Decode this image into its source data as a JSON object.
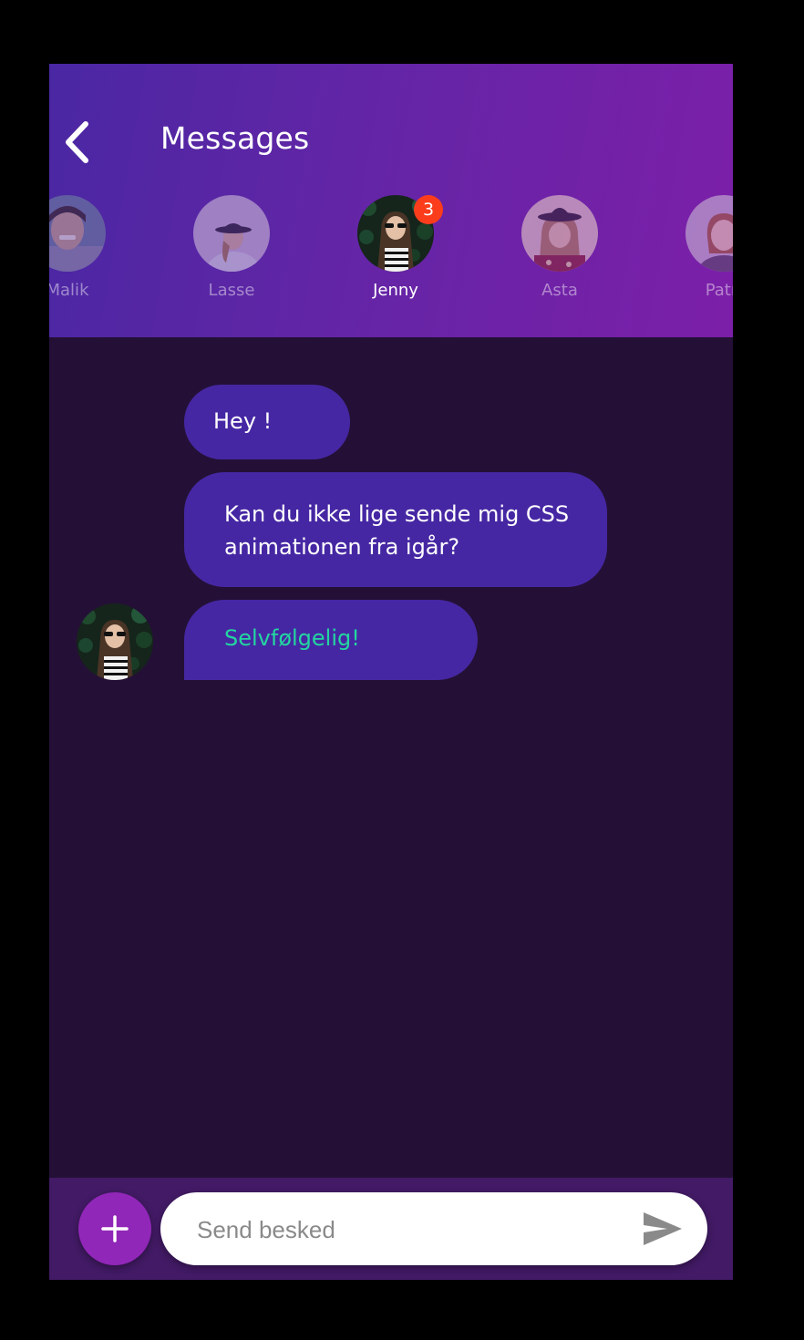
{
  "header": {
    "title": "Messages"
  },
  "contacts": [
    {
      "name": "Malik",
      "active": false,
      "badge": null
    },
    {
      "name": "Lasse",
      "active": false,
      "badge": null
    },
    {
      "name": "Jenny",
      "active": true,
      "badge": "3"
    },
    {
      "name": "Asta",
      "active": false,
      "badge": null
    },
    {
      "name": "Patri",
      "active": false,
      "badge": null
    }
  ],
  "messages": [
    {
      "text": "Hey !"
    },
    {
      "text": "Kan du ikke lige sende mig CSS animationen fra igår?"
    },
    {
      "text": "Selvfølgelig!"
    }
  ],
  "composer": {
    "placeholder": "Send besked"
  },
  "colors": {
    "header_gradient_start": "#4a27a3",
    "header_gradient_end": "#7c1fa8",
    "background": "#241036",
    "bubble": "#4627a3",
    "reply_text": "#23d6a0",
    "badge": "#fb3d1c",
    "add_button": "#9127b8"
  },
  "icons": {
    "back": "chevron-left-icon",
    "add": "plus-icon",
    "send": "send-icon"
  }
}
